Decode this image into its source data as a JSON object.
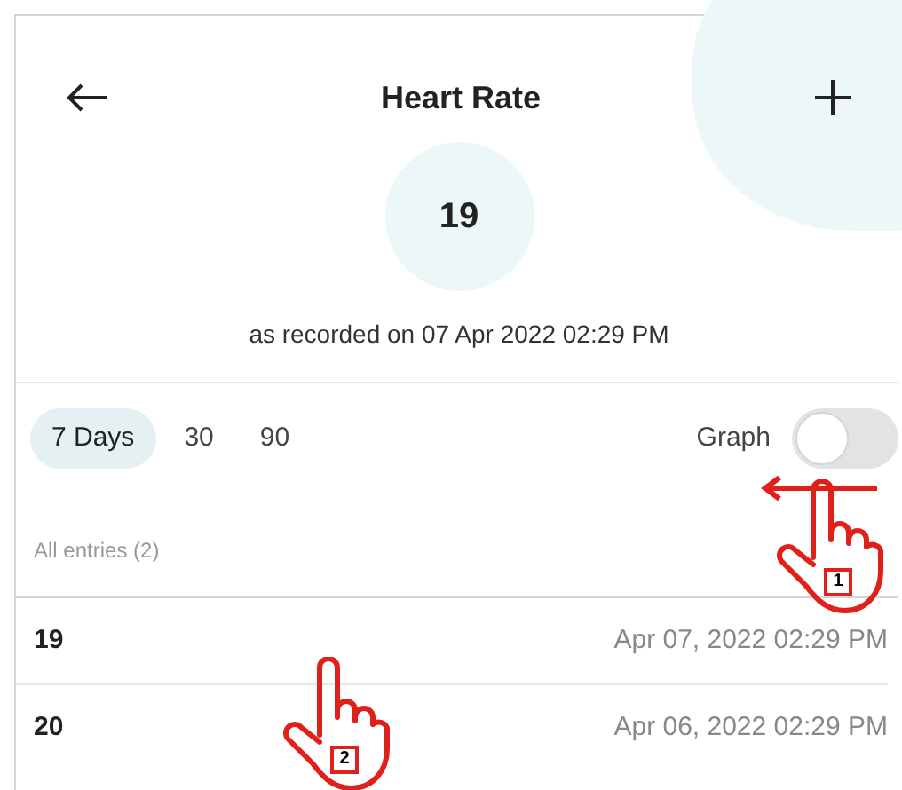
{
  "header": {
    "title": "Heart Rate"
  },
  "latest": {
    "value": "19",
    "caption": "as recorded on 07 Apr 2022 02:29 PM"
  },
  "ranges": [
    {
      "label": "7 Days",
      "selected": true
    },
    {
      "label": "30",
      "selected": false
    },
    {
      "label": "90",
      "selected": false
    }
  ],
  "graph_toggle": {
    "label": "Graph",
    "on": false
  },
  "entries": {
    "heading": "All entries (2)",
    "rows": [
      {
        "value": "19",
        "time": "Apr 07, 2022 02:29 PM"
      },
      {
        "value": "20",
        "time": "Apr 06, 2022 02:29 PM"
      }
    ]
  },
  "annotations": [
    {
      "label": "1",
      "kind": "swipe"
    },
    {
      "label": "2",
      "kind": "tap"
    }
  ]
}
